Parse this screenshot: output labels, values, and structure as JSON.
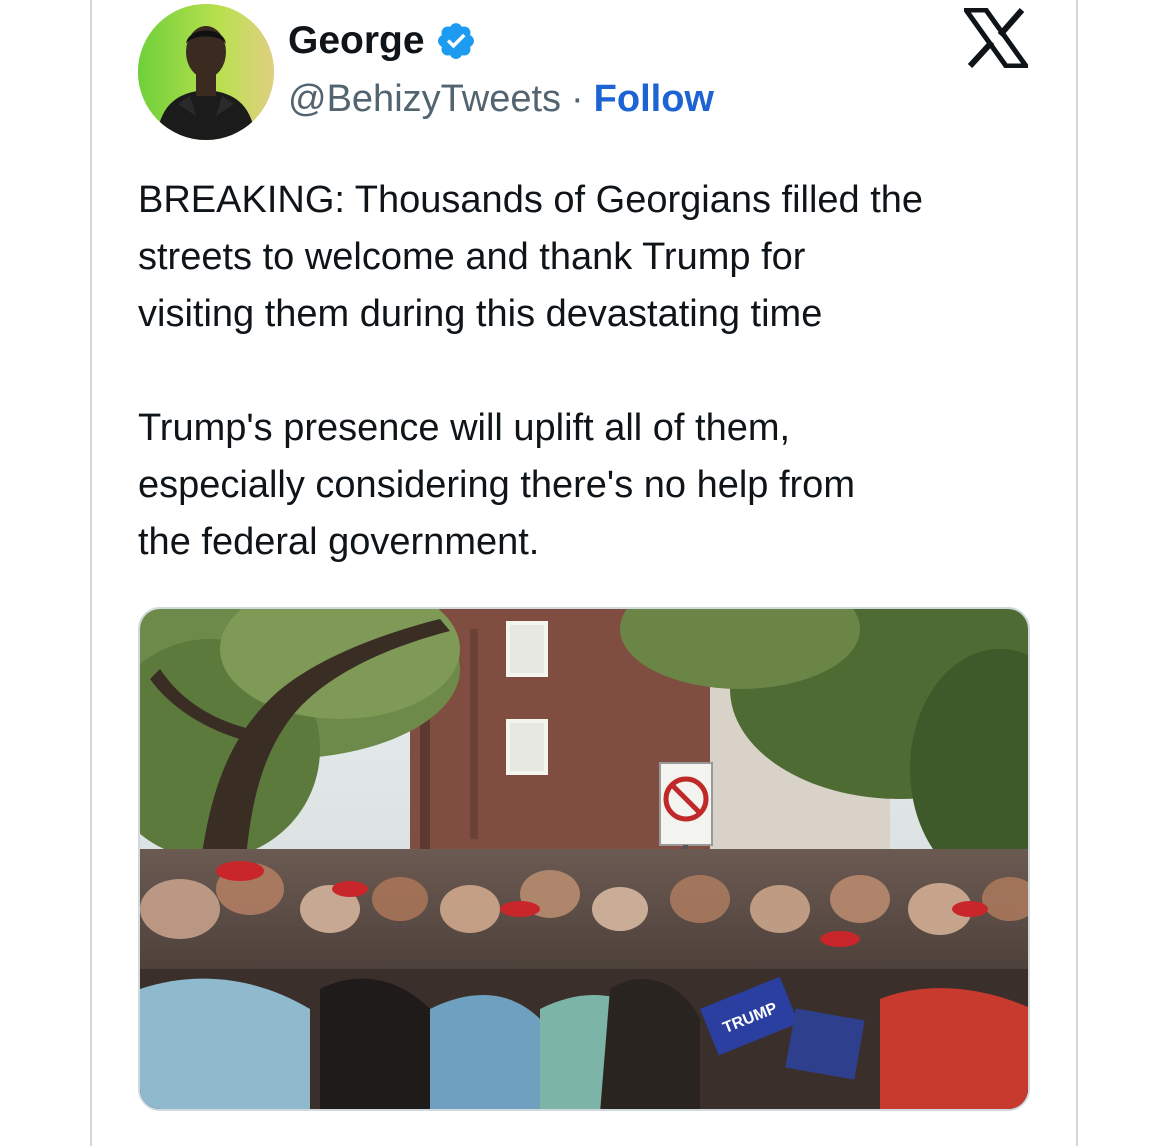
{
  "author": {
    "name": "George",
    "handle": "@BehizyTweets",
    "separator": "·",
    "follow_label": "Follow",
    "verified": true,
    "avatar_icon": "profile-photo"
  },
  "brand": {
    "icon": "x-logo-icon"
  },
  "tweet": {
    "paragraph_1": "BREAKING: Thousands of Georgians filled the\nstreets to welcome and thank Trump for\nvisiting them during this devastating time",
    "paragraph_2": "Trump's presence will uplift all of them,\nespecially considering there's no help from\nthe federal government."
  },
  "media": {
    "type": "video-thumbnail",
    "sign_text": "TRUMP"
  },
  "colors": {
    "follow": "#1d63d4",
    "verified_badge": "#1d9bf0",
    "secondary_text": "#536471",
    "border": "#cfd9de"
  }
}
